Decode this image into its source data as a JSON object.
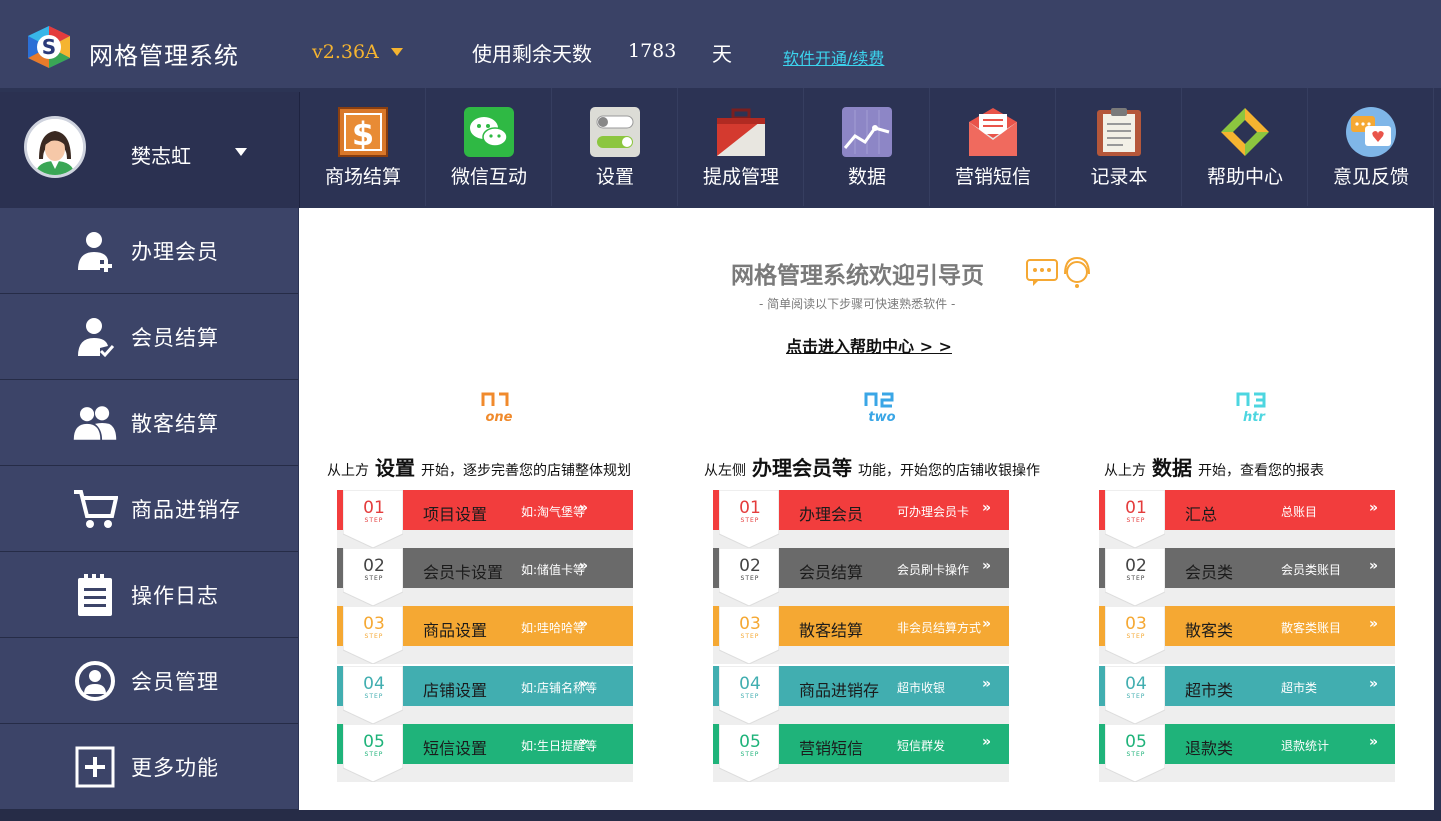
{
  "header": {
    "app_title": "网格管理系统",
    "version": "v2.36A",
    "days_label": "使用剩余天数",
    "days_value": "1783",
    "days_unit": "天",
    "renew_link": "软件开通/续费"
  },
  "user": {
    "name": "樊志虹"
  },
  "toolbar": [
    {
      "label": "商场结算",
      "icon": "dollar-icon"
    },
    {
      "label": "微信互动",
      "icon": "wechat-icon"
    },
    {
      "label": "设置",
      "icon": "toggle-settings-icon"
    },
    {
      "label": "提成管理",
      "icon": "briefcase-icon"
    },
    {
      "label": "数据",
      "icon": "chart-icon"
    },
    {
      "label": "营销短信",
      "icon": "envelope-icon"
    },
    {
      "label": "记录本",
      "icon": "notebook-icon"
    },
    {
      "label": "帮助中心",
      "icon": "help-arrows-icon"
    },
    {
      "label": "意见反馈",
      "icon": "feedback-chat-icon"
    }
  ],
  "sidebar": [
    {
      "label": "办理会员",
      "icon": "user-add-icon"
    },
    {
      "label": "会员结算",
      "icon": "user-check-icon"
    },
    {
      "label": "散客结算",
      "icon": "users-icon"
    },
    {
      "label": "商品进销存",
      "icon": "cart-icon"
    },
    {
      "label": "操作日志",
      "icon": "clipboard-icon"
    },
    {
      "label": "会员管理",
      "icon": "user-circle-icon"
    },
    {
      "label": "更多功能",
      "icon": "plus-box-icon"
    }
  ],
  "welcome": {
    "title": "网格管理系统欢迎引导页",
    "subtitle": "- 简单阅读以下步骤可快速熟悉软件 -",
    "help_link": "点击进入帮助中心 > >"
  },
  "columns": [
    {
      "num_color": "#f08a2c",
      "num_text": "one",
      "intro_pre": "从上方",
      "intro_big": "设置",
      "intro_post": "开始，逐步完善您的店铺整体规划",
      "steps": [
        {
          "num": "01",
          "name": "项目设置",
          "desc": "如:淘气堡等"
        },
        {
          "num": "02",
          "name": "会员卡设置",
          "desc": "如:储值卡等"
        },
        {
          "num": "03",
          "name": "商品设置",
          "desc": "如:哇哈哈等"
        },
        {
          "num": "04",
          "name": "店铺设置",
          "desc": "如:店铺名称等"
        },
        {
          "num": "05",
          "name": "短信设置",
          "desc": "如:生日提醒等"
        }
      ]
    },
    {
      "num_color": "#3aa6e6",
      "num_text": "two",
      "intro_pre": "从左侧",
      "intro_big": "办理会员等",
      "intro_post": "功能，开始您的店铺收银操作",
      "steps": [
        {
          "num": "01",
          "name": "办理会员",
          "desc": "可办理会员卡"
        },
        {
          "num": "02",
          "name": "会员结算",
          "desc": "会员刷卡操作"
        },
        {
          "num": "03",
          "name": "散客结算",
          "desc": "非会员结算方式"
        },
        {
          "num": "04",
          "name": "商品进销存",
          "desc": "超市收银"
        },
        {
          "num": "05",
          "name": "营销短信",
          "desc": "短信群发"
        }
      ]
    },
    {
      "num_color": "#4dd6e0",
      "num_text": "htr",
      "intro_pre": "从上方",
      "intro_big": "数据",
      "intro_post": "开始，查看您的报表",
      "steps": [
        {
          "num": "01",
          "name": "汇总",
          "desc": "总账目"
        },
        {
          "num": "02",
          "name": "会员类",
          "desc": "会员类账目"
        },
        {
          "num": "03",
          "name": "散客类",
          "desc": "散客类账目"
        },
        {
          "num": "04",
          "name": "超市类",
          "desc": "超市类"
        },
        {
          "num": "05",
          "name": "退款类",
          "desc": "退款统计"
        }
      ]
    }
  ],
  "step_sub": "STEP",
  "arrow": "»",
  "step_colors": [
    "#f23d3d",
    "#6a6a6a",
    "#f5a833",
    "#41aeb0",
    "#1fb37a"
  ]
}
